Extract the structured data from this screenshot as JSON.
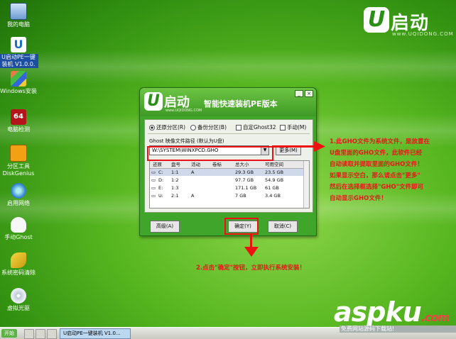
{
  "desktop_icons": [
    {
      "label": "我的电脑",
      "icon": "computer-icon"
    },
    {
      "label": "U启动PE一键\n装机 V1.0.0.",
      "icon": "u-logo-icon"
    },
    {
      "label": "Windows安装",
      "icon": "windows-setup-icon"
    },
    {
      "label": "电脑检测",
      "icon": "aida64-icon"
    },
    {
      "label": "分区工具\nDiskGenius",
      "icon": "disk-genius-icon"
    },
    {
      "label": "启用网络",
      "icon": "network-icon"
    },
    {
      "label": "手动Ghost",
      "icon": "ghost-icon"
    },
    {
      "label": "系统密码清除",
      "icon": "key-icon"
    },
    {
      "label": "虚拟光驱",
      "icon": "virtual-cd-icon"
    }
  ],
  "brand": {
    "u": "U",
    "name": "启动",
    "site": "www.UQIDONG.COM"
  },
  "dialog": {
    "logo_u": "U",
    "logo_name": "启动",
    "logo_site": "www.UQIDONG.COM",
    "title": "智能快速装机PE版本",
    "options": [
      "还原分区(R)",
      "备份分区(B)",
      "自定Ghost32",
      "手动(M)"
    ],
    "path_label": "Ghost 映像文件路径 (默认为U盘)",
    "path_value": "W:\\SYSTEM\\WINXPCD.GHO",
    "more_button": "更多(M)",
    "table_headers": [
      "还原",
      "盘号",
      "活动",
      "卷标",
      "总大小",
      "可用空间"
    ],
    "rows": [
      {
        "drive": "C:",
        "num": "1:1",
        "active": "A",
        "label": "",
        "size": "29.3 GB",
        "free": "23.5 GB"
      },
      {
        "drive": "D:",
        "num": "1:2",
        "active": "",
        "label": "",
        "size": "97.7 GB",
        "free": "54.9 GB"
      },
      {
        "drive": "E:",
        "num": "1:3",
        "active": "",
        "label": "",
        "size": "171.1 GB",
        "free": "61 GB"
      },
      {
        "drive": "U:",
        "num": "2:1",
        "active": "A",
        "label": "",
        "size": "7 GB",
        "free": "3.4 GB"
      }
    ],
    "advanced_button": "高级(A)",
    "ok_button": "确定(Y)",
    "cancel_button": "取消(C)"
  },
  "annotations": {
    "note1": [
      "1.此GHO文件为系统文件，是放置在",
      "U盘里面的GHO文件，此软件已经",
      "自动读取并提取里面的GHO文件！",
      "如果显示空白，那么请点击\"更多\"",
      "然后在选择框选择\"GHO\"文件即可",
      "自动显示GHO文件！"
    ],
    "note2": "2.点击\"确定\"按钮，立即执行系统安装！"
  },
  "taskbar": {
    "start": "开始",
    "task": "U启动PE一键装机 V1.0..."
  },
  "watermark": {
    "text": "aspku",
    "dotcom": ".com",
    "subtitle": "免费网站源码下载站!"
  },
  "colors": {
    "desktop_green": "#55b51f",
    "dialog_green": "#3fa52b",
    "annotation_red": "#e8161a"
  }
}
